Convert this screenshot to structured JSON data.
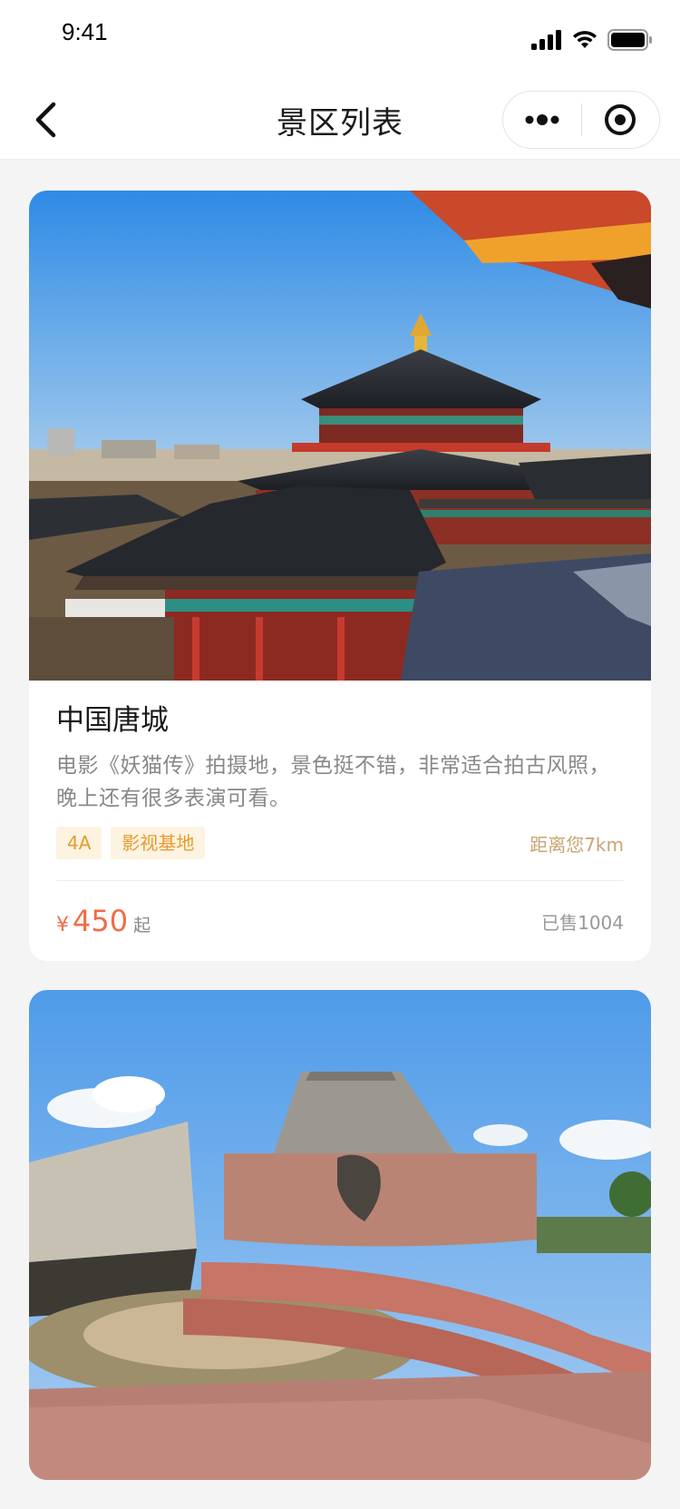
{
  "status_bar": {
    "time": "9:41"
  },
  "nav": {
    "title": "景区列表"
  },
  "spots": [
    {
      "name": "中国唐城",
      "description": "电影《妖猫传》拍摄地，景色挺不错，非常适合拍古风照，晚上还有很多表演可看。",
      "tags": [
        "4A",
        "影视基地"
      ],
      "distance": "距离您7km",
      "currency": "¥",
      "price": "450",
      "price_suffix": "起",
      "sold": "已售1004"
    }
  ],
  "colors": {
    "accent_price": "#f26b47",
    "tag_bg": "#fdf3e1",
    "tag_text": "#e89a2c",
    "distance_text": "#c9a472",
    "page_bg": "#f4f4f4"
  }
}
